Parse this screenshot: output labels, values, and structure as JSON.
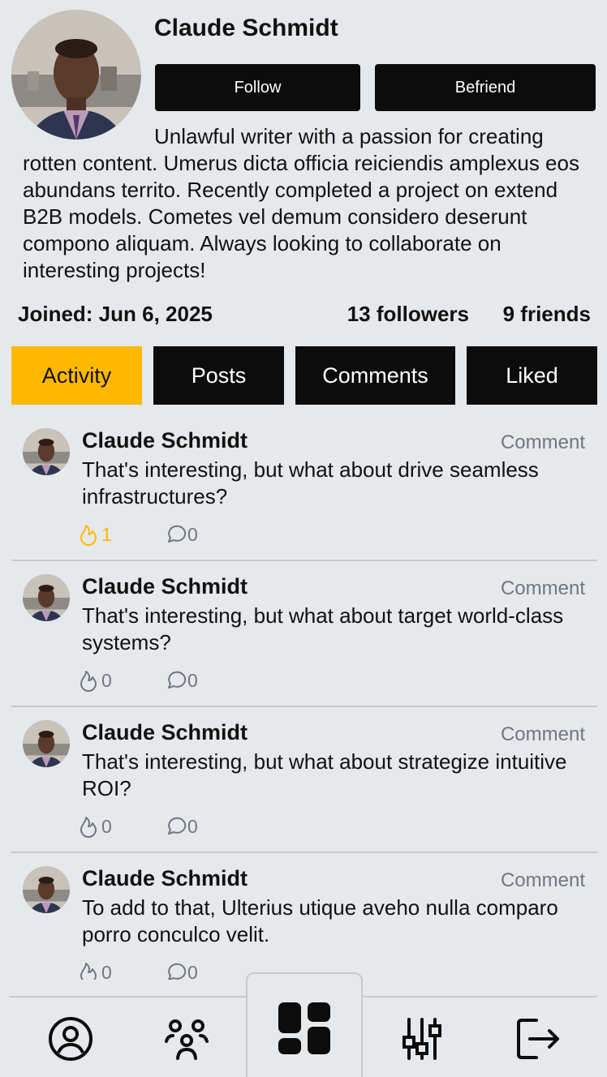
{
  "profile": {
    "name": "Claude Schmidt",
    "follow_label": "Follow",
    "befriend_label": "Befriend",
    "bio": "Unlawful writer with a passion for creating rotten content. Umerus dicta officia reiciendis amplexus eos abundans territo. Recently completed a project on extend B2B models. Cometes vel demum considero deserunt compono aliquam. Always looking to collaborate on interesting projects!",
    "joined": "Joined: Jun 6, 2025",
    "followers": "13 followers",
    "friends": "9 friends"
  },
  "tabs": [
    {
      "label": "Activity",
      "active": true
    },
    {
      "label": "Posts",
      "active": false
    },
    {
      "label": "Comments",
      "active": false
    },
    {
      "label": "Liked",
      "active": false
    }
  ],
  "feed": [
    {
      "author": "Claude Schmidt",
      "type": "Comment",
      "text": "That's interesting, but what about drive seamless infrastructures?",
      "likes": "1",
      "comments": "0",
      "liked": true
    },
    {
      "author": "Claude Schmidt",
      "type": "Comment",
      "text": "That's interesting, but what about target world-class systems?",
      "likes": "0",
      "comments": "0",
      "liked": false
    },
    {
      "author": "Claude Schmidt",
      "type": "Comment",
      "text": "That's interesting, but what about strategize intuitive ROI?",
      "likes": "0",
      "comments": "0",
      "liked": false
    },
    {
      "author": "Claude Schmidt",
      "type": "Comment",
      "text": "To add to that, Ulterius utique aveho nulla comparo porro conculco velit.",
      "likes": "0",
      "comments": "0",
      "liked": false
    }
  ],
  "nav": {
    "items": [
      "profile-icon",
      "friends-icon",
      "dashboard-icon",
      "settings-sliders-icon",
      "logout-icon"
    ],
    "active": "dashboard-icon"
  },
  "colors": {
    "accent": "#ffb800",
    "dark": "#0c0c0c",
    "background": "#e6e9eb",
    "muted": "#6f7781"
  }
}
